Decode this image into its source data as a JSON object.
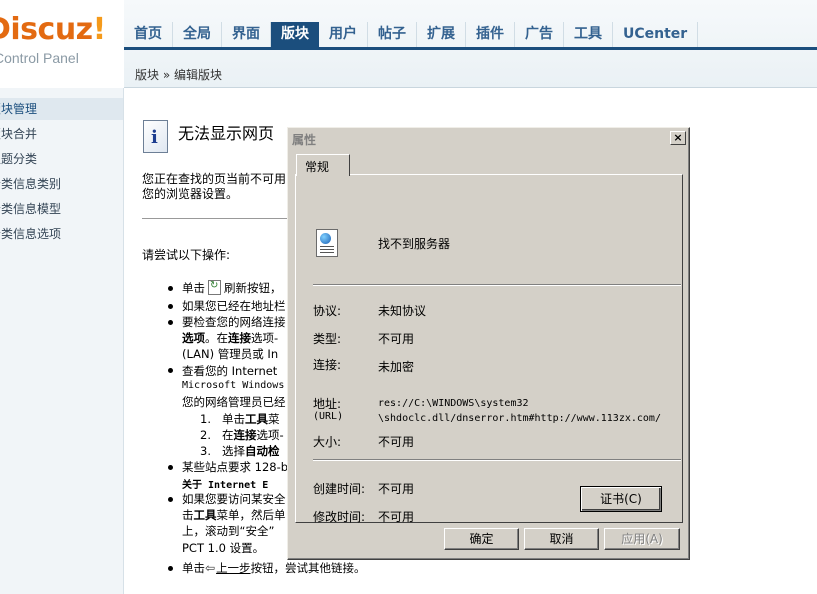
{
  "logo": {
    "text": "Discuz",
    "bang": "!",
    "subtitle": "Control Panel"
  },
  "topnav": {
    "items": [
      {
        "label": "首页",
        "active": false
      },
      {
        "label": "全局",
        "active": false
      },
      {
        "label": "界面",
        "active": false
      },
      {
        "label": "版块",
        "active": true
      },
      {
        "label": "用户",
        "active": false
      },
      {
        "label": "帖子",
        "active": false
      },
      {
        "label": "扩展",
        "active": false
      },
      {
        "label": "插件",
        "active": false
      },
      {
        "label": "广告",
        "active": false
      },
      {
        "label": "工具",
        "active": false
      },
      {
        "label": "UCenter",
        "active": false
      }
    ]
  },
  "breadcrumb": "版块 » 编辑版块",
  "sidebar": {
    "items": [
      {
        "label": "版块管理",
        "active": true
      },
      {
        "label": "版块合并",
        "active": false
      },
      {
        "label": "主题分类",
        "active": false
      },
      {
        "label": "分类信息类别",
        "active": false
      },
      {
        "label": "分类信息模型",
        "active": false
      },
      {
        "label": "分类信息选项",
        "active": false
      }
    ]
  },
  "error_page": {
    "title": "无法显示网页",
    "para_line1": "您正在查找的页当前不可用",
    "para_line2": "您的浏览器设置。",
    "try_heading": "请尝试以下操作:",
    "b1_pre": "单击",
    "b1_post": "刷新按钮，",
    "b2": "如果您已经在地址栏",
    "b3_line1": "要检查您的网络连接",
    "b3_line2_bold": "选项",
    "b3_line2_mid": "。在",
    "b3_line2_bold2": "连接",
    "b3_line2_end": "选项-",
    "b3_line3": "(LAN) 管理员或 In",
    "b4_line1": "查看您的 Internet",
    "b4_line2": "Microsoft Windows",
    "b4_line3": "您的网络管理员已经",
    "sub1_num": "1.",
    "sub1_pre": "单击",
    "sub1_bold": "工具",
    "sub1_post": "菜",
    "sub2_num": "2.",
    "sub2_pre": "在",
    "sub2_bold": "连接",
    "sub2_post": "选项-",
    "sub3_num": "3.",
    "sub3_pre": "选择",
    "sub3_bold": "自动检",
    "b5_line1": "某些站点要求 128-b",
    "b5_line2_bold": "关于 Internet E",
    "b6_line1": "如果您要访问某安全",
    "b6_line2_pre": "击",
    "b6_line2_bold": "工具",
    "b6_line2_post": "菜单，然后单",
    "b6_line3": "上，滚动到“安全”",
    "b6_line4": "PCT 1.0 设置。",
    "b7_pre": "单击",
    "b7_link": "上一步",
    "b7_post": "按钮，尝试其他链接。"
  },
  "dialog": {
    "title": "属性",
    "close": "×",
    "tab": "常规",
    "name": "找不到服务器",
    "rows": {
      "protocol_label": "协议:",
      "protocol_value": "未知协议",
      "type_label": "类型:",
      "type_value": "不可用",
      "connection_label": "连接:",
      "connection_value": "未加密",
      "address_label": "地址:",
      "address_label2": "(URL)",
      "address_line1": "res://C:\\WINDOWS\\system32",
      "address_line2": "\\shdoclc.dll/dnserror.htm#http://www.113zx.com/",
      "size_label": "大小:",
      "size_value": "不可用",
      "created_label": "创建时间:",
      "created_value": "不可用",
      "modified_label": "修改时间:",
      "modified_value": "不可用"
    },
    "buttons": {
      "certificate": "证书(C)",
      "ok": "确定",
      "cancel": "取消",
      "apply": "应用(A)"
    }
  }
}
